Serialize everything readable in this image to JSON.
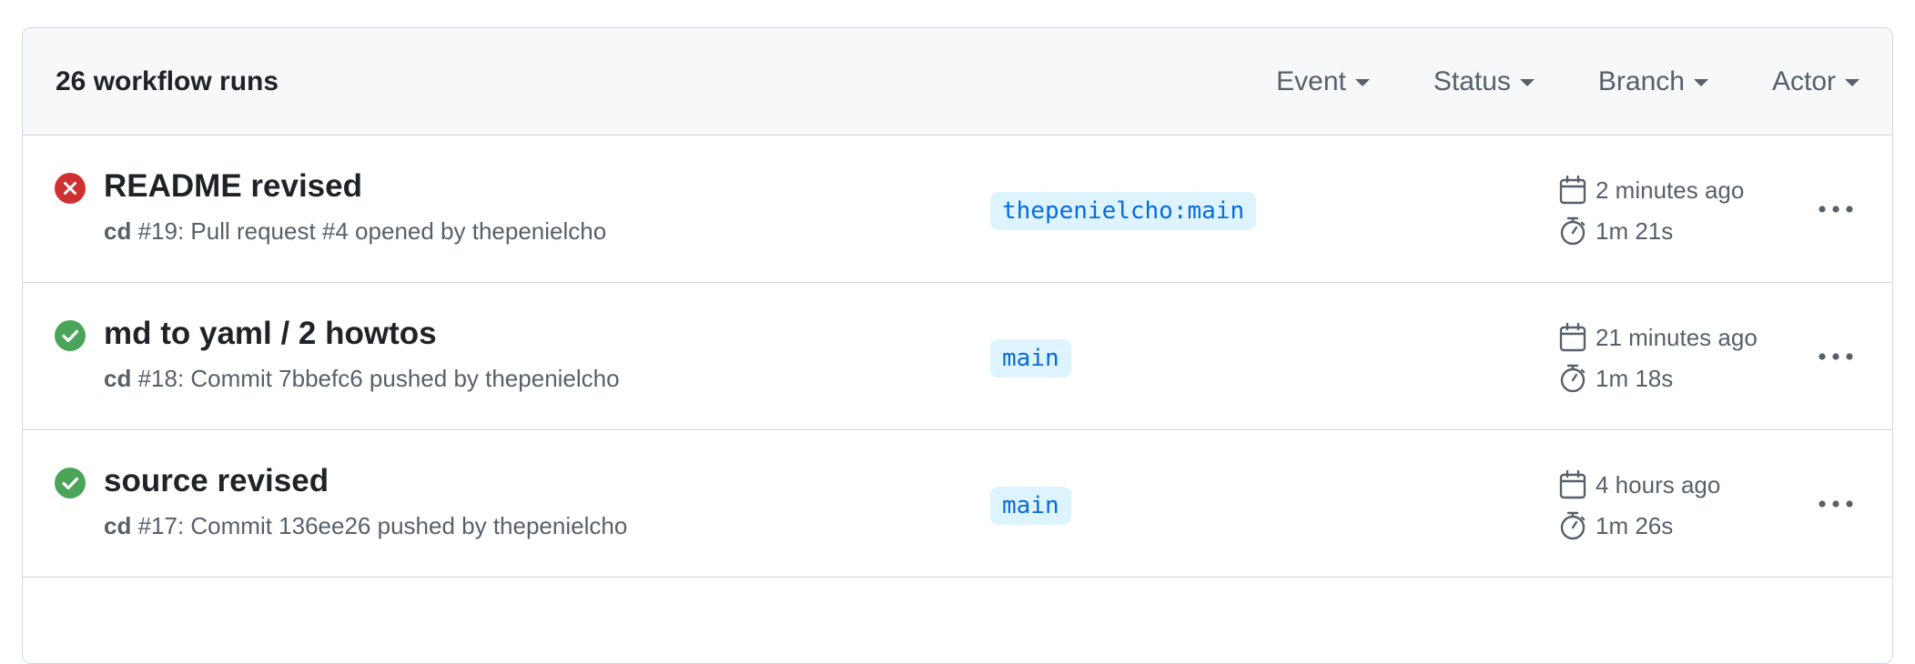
{
  "header": {
    "run_count": "26 workflow runs",
    "filters": [
      {
        "label": "Event"
      },
      {
        "label": "Status"
      },
      {
        "label": "Branch"
      },
      {
        "label": "Actor"
      }
    ]
  },
  "runs": [
    {
      "status": "failure",
      "status_icon": "x-circle-fill-icon",
      "title": "README revised",
      "workflow": "cd",
      "detail": " #19: Pull request #4 opened by thepenielcho",
      "branch": "thepenielcho:main",
      "when": "2 minutes ago",
      "duration": "1m 21s"
    },
    {
      "status": "success",
      "status_icon": "check-circle-fill-icon",
      "title": "md to yaml / 2 howtos",
      "workflow": "cd",
      "detail": " #18: Commit 7bbefc6 pushed by thepenielcho",
      "branch": "main",
      "when": "21 minutes ago",
      "duration": "1m 18s"
    },
    {
      "status": "success",
      "status_icon": "check-circle-fill-icon",
      "title": "source revised",
      "workflow": "cd",
      "detail": " #17: Commit 136ee26 pushed by thepenielcho",
      "branch": "main",
      "when": "4 hours ago",
      "duration": "1m 26s"
    }
  ],
  "colors": {
    "failure": "#cf222e",
    "success": "#1a7f37",
    "success_icon_fill": "#4aa55a",
    "failure_icon_fill": "#cf3131",
    "branch_bg": "#ddf4ff",
    "branch_text": "#0969da",
    "border": "#d0d7de",
    "header_bg": "#f6f8fa"
  }
}
